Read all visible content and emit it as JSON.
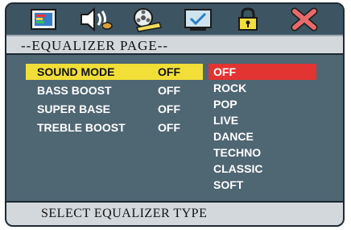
{
  "toolbar": {
    "icons": [
      "monitor-settings-icon",
      "speaker-audio-icon",
      "film-reel-icon",
      "checkbox-screen-icon",
      "padlock-icon",
      "close-x-icon"
    ]
  },
  "page": {
    "title": "--EQUALIZER PAGE--"
  },
  "settings": [
    {
      "label": "SOUND MODE",
      "value": "OFF"
    },
    {
      "label": "BASS BOOST",
      "value": "OFF"
    },
    {
      "label": "SUPER BASE",
      "value": "OFF"
    },
    {
      "label": "TREBLE BOOST",
      "value": "OFF"
    }
  ],
  "options": [
    "OFF",
    "ROCK",
    "POP",
    "LIVE",
    "DANCE",
    "TECHNO",
    "CLASSIC",
    "SOFT"
  ],
  "status": {
    "text": "SELECT EQUALIZER TYPE"
  },
  "colors": {
    "frame": "#4f6673",
    "topbar": "#3d5562",
    "selected_row": "#f1df38",
    "selected_option": "#e23432",
    "bars": "#d3d8dc"
  }
}
